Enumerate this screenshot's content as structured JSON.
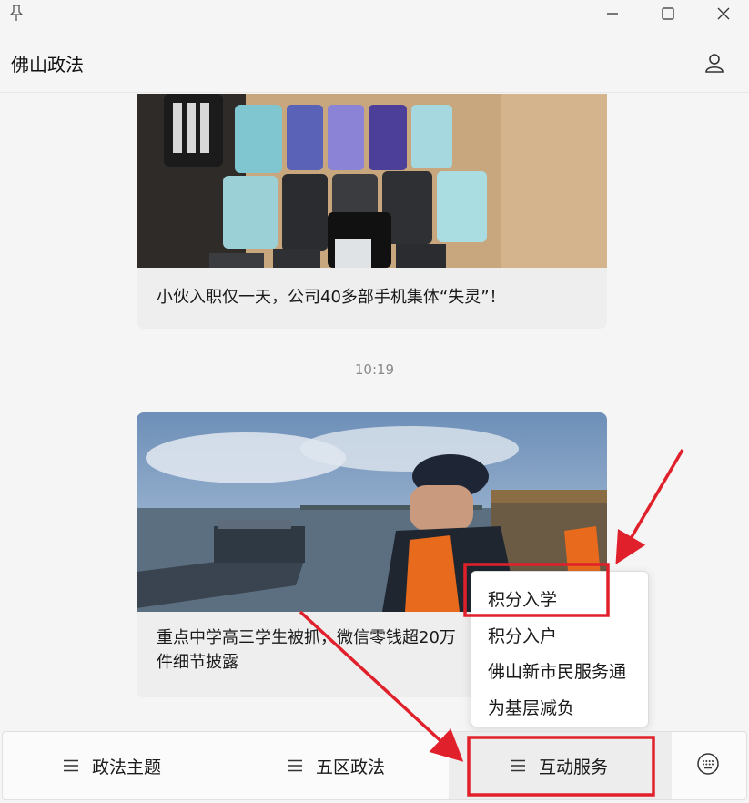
{
  "window": {
    "pin_icon": "pin-icon",
    "minimize_icon": "minimize-icon",
    "maximize_icon": "maximize-icon",
    "close_icon": "close-icon"
  },
  "header": {
    "title": "佛山政法",
    "profile_icon": "user-icon"
  },
  "feed": {
    "messages": [
      {
        "type": "article",
        "image": "phones-on-table-photo",
        "title": "小伙入职仅一天，公司40多部手机集体“失灵”！"
      },
      {
        "type": "timestamp",
        "text": "10:19"
      },
      {
        "type": "article",
        "image": "officer-on-boat-photo",
        "title_line1": "重点中学高三学生被抓，微信零钱超20万",
        "title_line2": "件细节披露"
      }
    ]
  },
  "popup_menu": {
    "items": [
      "积分入学",
      "积分入户",
      "佛山新市民服务通",
      "为基层减负"
    ],
    "highlighted_index": 0
  },
  "bottom_menu": {
    "tabs": [
      {
        "label": "政法主题",
        "icon": "menu-icon"
      },
      {
        "label": "五区政法",
        "icon": "menu-icon"
      },
      {
        "label": "互动服务",
        "icon": "menu-icon",
        "active": true
      }
    ],
    "keyboard_icon": "keyboard-icon"
  },
  "annotations": {
    "color": "#e0212b"
  }
}
